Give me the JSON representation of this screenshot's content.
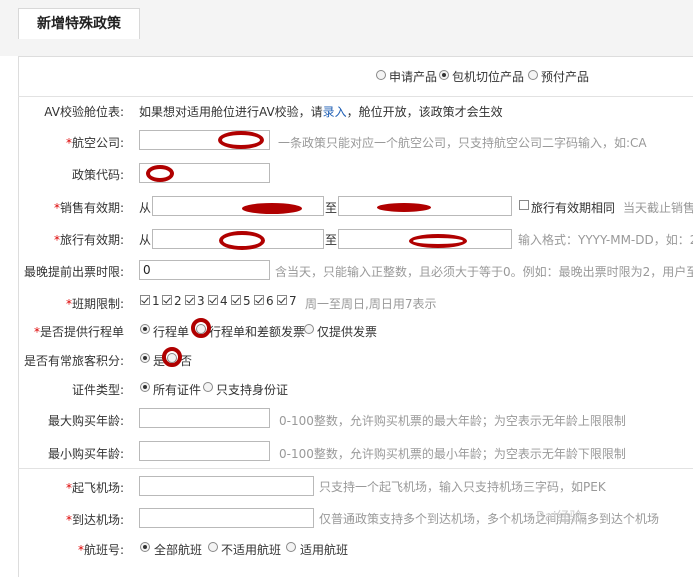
{
  "tab_title": "新增特殊政策",
  "product_type": {
    "options": [
      "申请产品",
      "包机切位产品",
      "预付产品"
    ],
    "selected": "包机切位产品"
  },
  "av_check": {
    "label": "AV校验舱位表:",
    "text_before": "如果想对适用舱位进行AV校验，请",
    "link": "录入",
    "text_after": "，舱位开放，该政策才会生效"
  },
  "airline": {
    "label": "航空公司:",
    "required": "*",
    "hint": "一条政策只能对应一个航空公司，只支持航空公司二字码输入，如:CA"
  },
  "policy_code": {
    "label": "政策代码:"
  },
  "sale_period": {
    "label": "销售有效期:",
    "required": "*",
    "from": "从",
    "to": "至",
    "checkbox_label": "旅行有效期相同",
    "hint": "当天截止销售"
  },
  "travel_period": {
    "label": "旅行有效期:",
    "required": "*",
    "from": "从",
    "to": "至",
    "hint": "输入格式：YYYY-MM-DD，如：2"
  },
  "advance_time": {
    "label": "最晚提前出票时限:",
    "value": "0",
    "hint": "含当天，只能输入正整数，且必须大于等于0。例如：最晚出票时限为2，用户至"
  },
  "flight_days": {
    "label": "班期限制:",
    "required": "*",
    "days": [
      "1",
      "2",
      "3",
      "4",
      "5",
      "6",
      "7"
    ],
    "hint": "周一至周日,周日用7表示"
  },
  "itinerary": {
    "label": "是否提供行程单",
    "required": "*",
    "options": [
      "行程单",
      "行程单和差额发票",
      "仅提供发票"
    ],
    "selected": "行程单"
  },
  "frequent_flyer": {
    "label": "是否有常旅客积分:",
    "options": [
      "是",
      "否"
    ],
    "selected": "是"
  },
  "id_type": {
    "label": "证件类型:",
    "options": [
      "所有证件",
      "只支持身份证"
    ],
    "selected": "所有证件"
  },
  "max_age": {
    "label": "最大购买年龄:",
    "hint": "0-100整数，允许购买机票的最大年龄；为空表示无年龄上限限制"
  },
  "min_age": {
    "label": "最小购买年龄:",
    "hint": "0-100整数，允许购买机票的最小年龄；为空表示无年龄下限限制"
  },
  "depart_airport": {
    "label": "起飞机场:",
    "required": "*",
    "hint": "只支持一个起飞机场，输入只支持机场三字码，如PEK"
  },
  "arrive_airport": {
    "label": "到达机场:",
    "required": "*",
    "hint": "仅普通政策支持多个到达机场，多个机场之间用/隔多到达个机场"
  },
  "flight_no": {
    "label": "航班号:",
    "required": "*",
    "options": [
      "全部航班",
      "不适用航班",
      "适用航班"
    ],
    "selected": "全部航班"
  },
  "watermark": "Bai经验"
}
